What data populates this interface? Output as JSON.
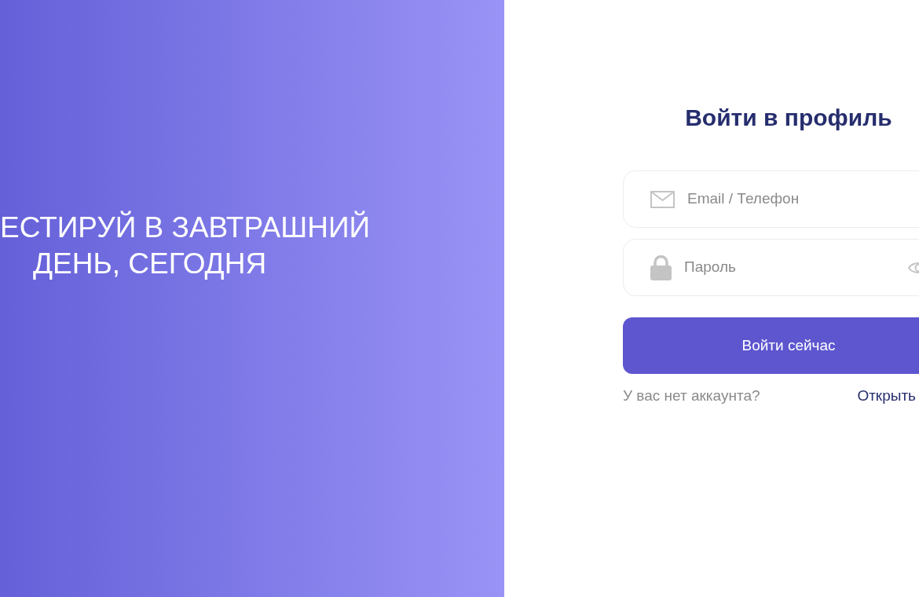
{
  "hero": {
    "lines": [
      "ЕСТИРУЙ В ЗАВТРАШНИЙ",
      "ДЕНЬ, СЕГОДНЯ"
    ]
  },
  "form": {
    "title": "Войти в профиль",
    "fields": [
      {
        "kind": "email",
        "placeholder": "Email / Телефон"
      },
      {
        "kind": "password",
        "placeholder": "Пароль"
      }
    ],
    "submit": "Войти сейчас",
    "footer": {
      "question": "У вас нет аккаунта?",
      "link": "Открыть"
    }
  }
}
